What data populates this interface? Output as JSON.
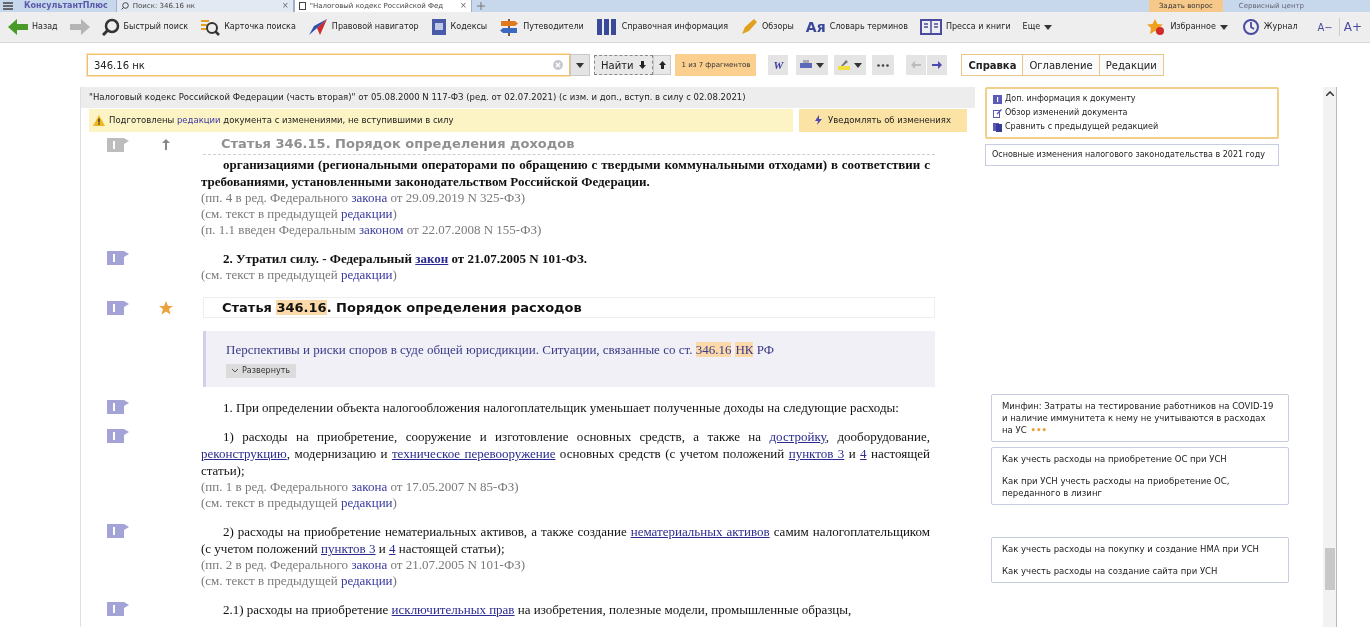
{
  "tabs": [
    {
      "label": "КонсультантПлюс",
      "kind": "logo",
      "selected": false
    },
    {
      "label": "Поиск: 346.16 нк",
      "kind": "search",
      "selected": false,
      "close": "×"
    },
    {
      "label": "\"Налоговый кодекс Российской Фед",
      "kind": "doc",
      "selected": true,
      "close": "×"
    }
  ],
  "top_buttons": [
    "Задать вопрос",
    "Сервисный центр"
  ],
  "toolbar": {
    "items": [
      {
        "label": "Назад",
        "kind": "back"
      },
      {
        "kind": "forward"
      },
      {
        "label": "Быстрый поиск",
        "kind": "search"
      },
      {
        "label": "Карточка поиска",
        "kind": "card"
      },
      {
        "label": "Правовой навигатор",
        "kind": "nav"
      },
      {
        "label": "Кодексы",
        "kind": "codes"
      },
      {
        "label": "Путеводители",
        "kind": "guide"
      },
      {
        "label": "Справочная информация",
        "kind": "ref"
      },
      {
        "label": "Обзоры",
        "kind": "review"
      },
      {
        "label": "Словарь терминов",
        "kind": "dict",
        "icon_text": "Aя"
      },
      {
        "label": "Пресса и книги",
        "kind": "press"
      },
      {
        "label": "Еще",
        "kind": "more"
      }
    ],
    "right": [
      {
        "label": "Избранное",
        "kind": "fav"
      },
      {
        "label": "Журнал",
        "kind": "journal"
      }
    ],
    "font_buttons": [
      "A−",
      "A+"
    ]
  },
  "search": {
    "value": "346.16 нк",
    "find": "Найти",
    "fragments": "1 из 7 фрагментов",
    "word_button": "W"
  },
  "panel_tabs": [
    {
      "label": "Справка",
      "selected": true
    },
    {
      "label": "Оглавление",
      "selected": false
    },
    {
      "label": "Редакции",
      "selected": false
    }
  ],
  "document": {
    "title": "\"Налоговый кодекс Российской Федерации (часть вторая)\" от 05.08.2000 N 117-ФЗ (ред. от 02.07.2021) (с изм. и доп., вступ. в силу с 02.08.2021)",
    "warning": {
      "parts": [
        {
          "text": "Подготовлены ",
          "kind": "plain"
        },
        {
          "text": "редакции",
          "kind": "link"
        },
        {
          "text": " документа с изменениями, не вступившими в силу",
          "kind": "plain"
        }
      ],
      "button": "Уведомлять об изменениях"
    },
    "blocks": [
      {
        "kind": "heading",
        "faded": true,
        "marker": true,
        "parts": [
          {
            "text": "Статья 346.15. Порядок определения доходов",
            "kind": "plain"
          }
        ]
      },
      {
        "kind": "para",
        "bold": true,
        "marker": false,
        "parts": [
          {
            "text": "организациями (региональными операторами по обращению с твердыми коммунальными отходами) в соответствии с требованиями, установленными законодательством Российской Федерации.",
            "kind": "plain"
          }
        ]
      },
      {
        "kind": "note",
        "parts": [
          {
            "text": "(пп. 4 в ред. Федерального ",
            "kind": "plain"
          },
          {
            "text": "закона",
            "kind": "link"
          },
          {
            "text": " от 29.09.2019 N 325-ФЗ)",
            "kind": "plain"
          }
        ]
      },
      {
        "kind": "note",
        "parts": [
          {
            "text": "(см. текст в предыдущей ",
            "kind": "plain"
          },
          {
            "text": "редакции",
            "kind": "link"
          },
          {
            "text": ")",
            "kind": "plain"
          }
        ]
      },
      {
        "kind": "note",
        "parts": [
          {
            "text": "(п. 1.1 введен Федеральным ",
            "kind": "plain"
          },
          {
            "text": "законом",
            "kind": "link"
          },
          {
            "text": " от 22.07.2008 N 155-ФЗ)",
            "kind": "plain"
          }
        ]
      },
      {
        "kind": "para",
        "bold": true,
        "marker": true,
        "parts": [
          {
            "text": "2. Утратил силу. - Федеральный ",
            "kind": "plain"
          },
          {
            "text": "закон",
            "kind": "ulink"
          },
          {
            "text": " от 21.07.2005 N 101-ФЗ.",
            "kind": "plain"
          }
        ]
      },
      {
        "kind": "note",
        "parts": [
          {
            "text": "(см. текст в предыдущей ",
            "kind": "plain"
          },
          {
            "text": "редакции",
            "kind": "link"
          },
          {
            "text": ")",
            "kind": "plain"
          }
        ]
      },
      {
        "kind": "heading",
        "faded": false,
        "marker": true,
        "parts": [
          {
            "text": "Статья ",
            "kind": "plain"
          },
          {
            "text": "346.16",
            "kind": "hl"
          },
          {
            "text": ". Порядок определения расходов",
            "kind": "plain"
          }
        ]
      },
      {
        "kind": "summary",
        "button": "Развернуть",
        "parts": [
          {
            "text": "Перспективы и риски споров в суде общей юрисдикции. Ситуации, связанные со ст. ",
            "kind": "plain"
          },
          {
            "text": "346.16",
            "kind": "hl"
          },
          {
            "text": "НК",
            "kind": "hl"
          },
          {
            "text": " РФ",
            "kind": "plain"
          }
        ]
      },
      {
        "kind": "para",
        "bold": false,
        "marker": true,
        "parts": [
          {
            "text": "1. При определении объекта налогообложения налогоплательщик уменьшает полученные доходы на следующие расходы:",
            "kind": "plain"
          }
        ]
      },
      {
        "kind": "para",
        "bold": false,
        "marker": true,
        "parts": [
          {
            "text": "1) расходы на приобретение, сооружение и изготовление основных средств, а также на ",
            "kind": "plain"
          },
          {
            "text": "достройку",
            "kind": "ulink"
          },
          {
            "text": ", дооборудование, ",
            "kind": "plain"
          },
          {
            "text": "реконструкцию",
            "kind": "ulink"
          },
          {
            "text": ", модернизацию и ",
            "kind": "plain"
          },
          {
            "text": "техническое перевооружение",
            "kind": "ulink"
          },
          {
            "text": " основных средств (с учетом положений ",
            "kind": "plain"
          },
          {
            "text": "пунктов 3",
            "kind": "ulink"
          },
          {
            "text": " и ",
            "kind": "plain"
          },
          {
            "text": "4",
            "kind": "ulink"
          },
          {
            "text": " настоящей статьи);",
            "kind": "plain"
          }
        ]
      },
      {
        "kind": "note",
        "parts": [
          {
            "text": "(пп. 1 в ред. Федерального ",
            "kind": "plain"
          },
          {
            "text": "закона",
            "kind": "link"
          },
          {
            "text": " от 17.05.2007 N 85-ФЗ)",
            "kind": "plain"
          }
        ]
      },
      {
        "kind": "note",
        "parts": [
          {
            "text": "(см. текст в предыдущей ",
            "kind": "plain"
          },
          {
            "text": "редакции",
            "kind": "link"
          },
          {
            "text": ")",
            "kind": "plain"
          }
        ]
      },
      {
        "kind": "para",
        "bold": false,
        "marker": true,
        "parts": [
          {
            "text": "2) расходы на приобретение нематериальных активов, а также создание ",
            "kind": "plain"
          },
          {
            "text": "нематериальных активов",
            "kind": "ulink"
          },
          {
            "text": " самим налогоплательщиком (с учетом положений ",
            "kind": "plain"
          },
          {
            "text": "пунктов 3",
            "kind": "ulink"
          },
          {
            "text": " и ",
            "kind": "plain"
          },
          {
            "text": "4",
            "kind": "ulink"
          },
          {
            "text": " настоящей статьи);",
            "kind": "plain"
          }
        ]
      },
      {
        "kind": "note",
        "parts": [
          {
            "text": "(пп. 2 в ред. Федерального ",
            "kind": "plain"
          },
          {
            "text": "закона",
            "kind": "link"
          },
          {
            "text": " от 21.07.2005 N 101-ФЗ)",
            "kind": "plain"
          }
        ]
      },
      {
        "kind": "note",
        "parts": [
          {
            "text": "(см. текст в предыдущей ",
            "kind": "plain"
          },
          {
            "text": "редакции",
            "kind": "link"
          },
          {
            "text": ")",
            "kind": "plain"
          }
        ]
      },
      {
        "kind": "para",
        "bold": false,
        "marker": true,
        "parts": [
          {
            "text": "2.1) расходы на приобретение ",
            "kind": "plain"
          },
          {
            "text": "исключительных прав",
            "kind": "ulink"
          },
          {
            "text": " на изобретения, полезные модели, промышленные образцы,",
            "kind": "plain"
          }
        ]
      }
    ]
  },
  "sidebar": {
    "links": [
      {
        "label": "Доп. информация к документу",
        "kind": "info"
      },
      {
        "label": "Обзор изменений документа",
        "kind": "edit"
      },
      {
        "label": "Сравнить с предыдущей редакцией",
        "kind": "compare"
      }
    ],
    "news": "Основные изменения налогового законодательства в 2021 году",
    "notes": [
      {
        "items": [
          "Минфин: Затраты на тестирование работников на COVID-19 и наличие иммунитета к нему не учитываются в расходах на УС"
        ],
        "more": "•••"
      },
      {
        "items": [
          "Как учесть расходы на приобретение ОС при УСН",
          "Как при УСН учесть расходы на приобретение ОС, переданного в лизинг"
        ]
      },
      {
        "items": [
          "Как учесть расходы на покупку и создание НМА при УСН",
          "Как учесть расходы на создание сайта при УСН"
        ]
      }
    ]
  }
}
